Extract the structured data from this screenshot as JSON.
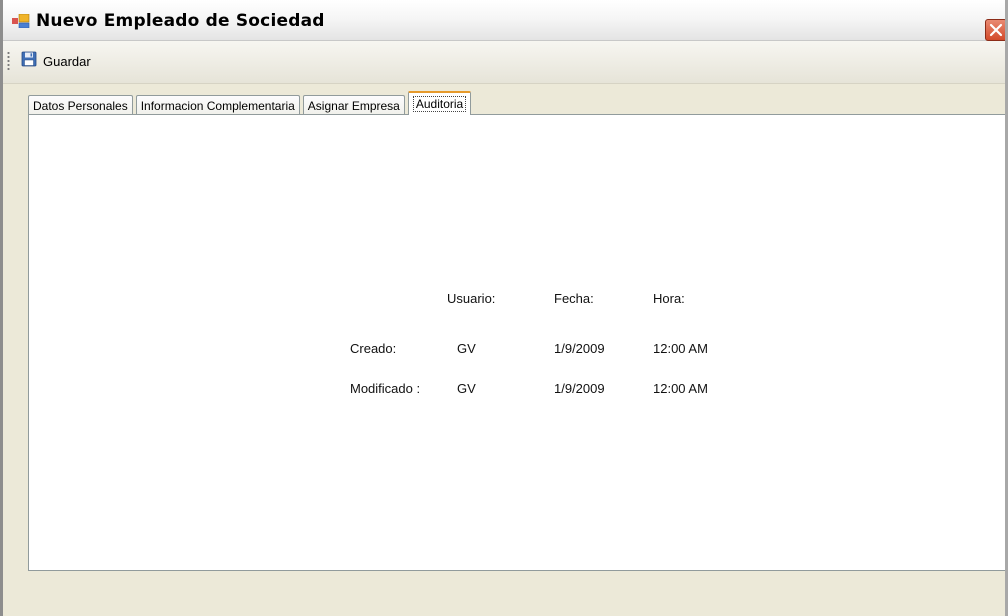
{
  "window": {
    "title": "Nuevo Empleado de Sociedad",
    "app_icon": "form-window-icon",
    "close_icon": "close-icon"
  },
  "toolbar": {
    "save_label": "Guardar",
    "save_icon": "floppy-disk-icon"
  },
  "tabs": [
    {
      "label": "Datos Personales",
      "active": false
    },
    {
      "label": "Informacion Complementaria",
      "active": false
    },
    {
      "label": "Asignar Empresa",
      "active": false
    },
    {
      "label": "Auditoria",
      "active": true
    }
  ],
  "audit": {
    "headers": {
      "usuario": "Usuario:",
      "fecha": "Fecha:",
      "hora": "Hora:"
    },
    "rows": [
      {
        "label": "Creado:",
        "usuario": "GV",
        "fecha": "1/9/2009",
        "hora": "12:00 AM"
      },
      {
        "label": "Modificado :",
        "usuario": "GV",
        "fecha": "1/9/2009",
        "hora": "12:00 AM"
      }
    ]
  },
  "colors": {
    "accent_tab": "#e69a2b",
    "window_face": "#ece9d8",
    "close_button": "#d34a2a"
  }
}
